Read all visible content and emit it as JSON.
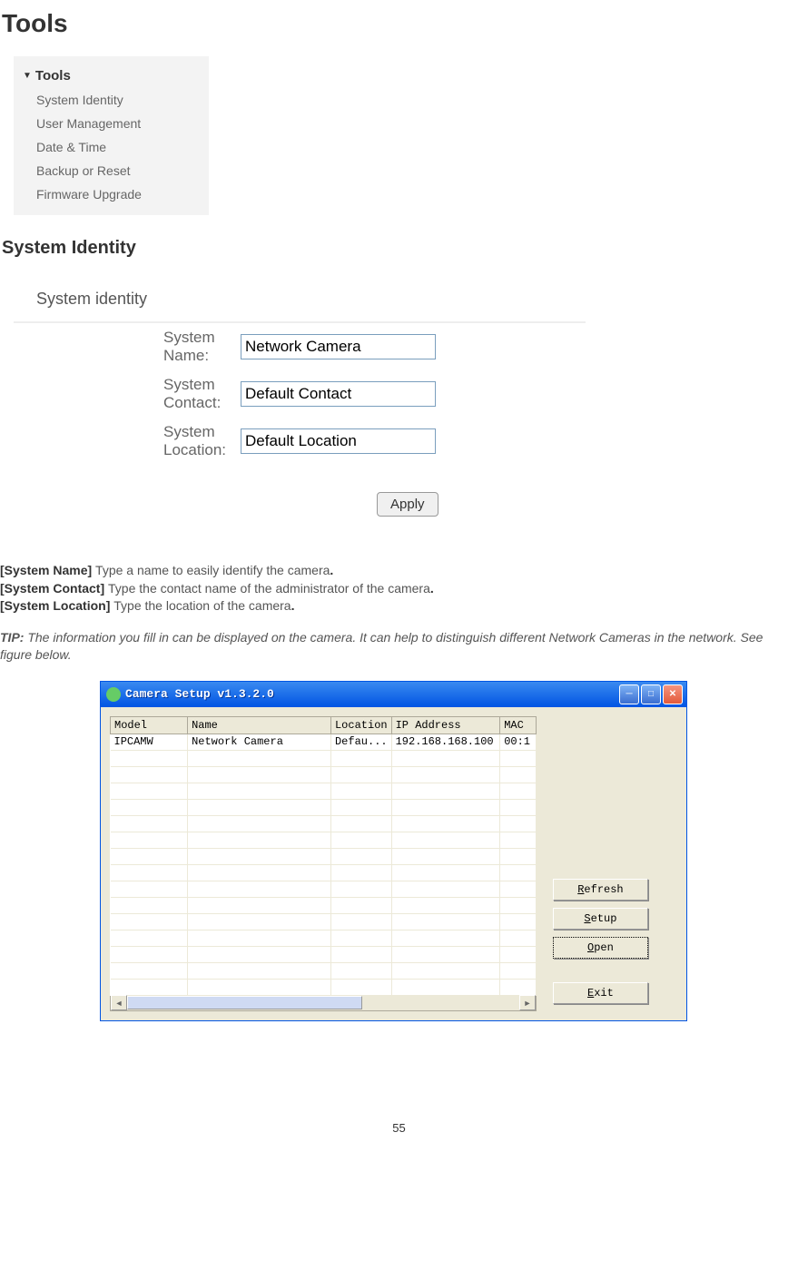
{
  "page_title": "Tools",
  "tools_menu": {
    "header": "Tools",
    "items": [
      "System Identity",
      "User Management",
      "Date & Time",
      "Backup or Reset",
      "Firmware Upgrade"
    ]
  },
  "section_title": "System Identity",
  "panel_header": "System identity",
  "form": {
    "fields": [
      {
        "label": "System Name:",
        "value": "Network Camera"
      },
      {
        "label": "System Contact:",
        "value": "Default Contact"
      },
      {
        "label": "System Location:",
        "value": "Default Location"
      }
    ],
    "apply_label": "Apply"
  },
  "descriptions": [
    {
      "label": "[System Name] ",
      "text": "Type a name to easily identify the camera",
      "suffix": "."
    },
    {
      "label": "[System Contact] ",
      "text": "Type the contact name of the administrator of the camera",
      "suffix": "."
    },
    {
      "label": "[System Location] ",
      "text": "Type the location of the camera",
      "suffix": "."
    }
  ],
  "tip": {
    "label": "TIP: ",
    "text": "The information you fill in can be displayed on the camera. It can help to distinguish different Network Cameras in the network. See figure below."
  },
  "camera_setup": {
    "title": "Camera Setup v1.3.2.0",
    "columns": [
      "Model",
      "Name",
      "Location",
      "IP Address",
      "MAC"
    ],
    "rows": [
      [
        "IPCAMW",
        "Network Camera",
        "Defau...",
        "192.168.168.100",
        "00:1"
      ]
    ],
    "buttons": {
      "refresh": "Refresh",
      "setup": "Setup",
      "open": "Open",
      "exit": "Exit"
    }
  },
  "page_number": "55"
}
